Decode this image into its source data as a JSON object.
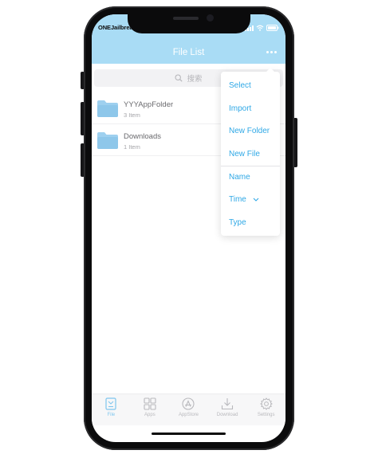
{
  "status_bar": {
    "carrier": "ONEJailbreak"
  },
  "header": {
    "title": "File List",
    "more_icon": "more-dots-icon"
  },
  "search": {
    "placeholder": "搜索",
    "icon": "search-icon"
  },
  "files": [
    {
      "name": "YYYAppFolder",
      "count": "3 Item",
      "icon": "folder-icon"
    },
    {
      "name": "Downloads",
      "count": "1 Item",
      "icon": "folder-icon"
    }
  ],
  "menu": {
    "actions": [
      "Select",
      "Import",
      "New Folder",
      "New File"
    ],
    "sort": [
      "Name",
      "Time",
      "Type"
    ],
    "active_sort_icon": "chevron-down-icon"
  },
  "tabs": [
    {
      "label": "File",
      "icon": "file-icon",
      "active": true
    },
    {
      "label": "Apps",
      "icon": "apps-grid-icon",
      "active": false
    },
    {
      "label": "AppStore",
      "icon": "appstore-icon",
      "active": false
    },
    {
      "label": "Download",
      "icon": "download-icon",
      "active": false
    },
    {
      "label": "Settings",
      "icon": "gear-icon",
      "active": false
    }
  ],
  "colors": {
    "header": "#a9dcf5",
    "accent": "#2fa8e6",
    "folder": "#9ed0ef",
    "tab_active": "#7fc6ee",
    "tab_inactive": "#b9b9bd"
  }
}
